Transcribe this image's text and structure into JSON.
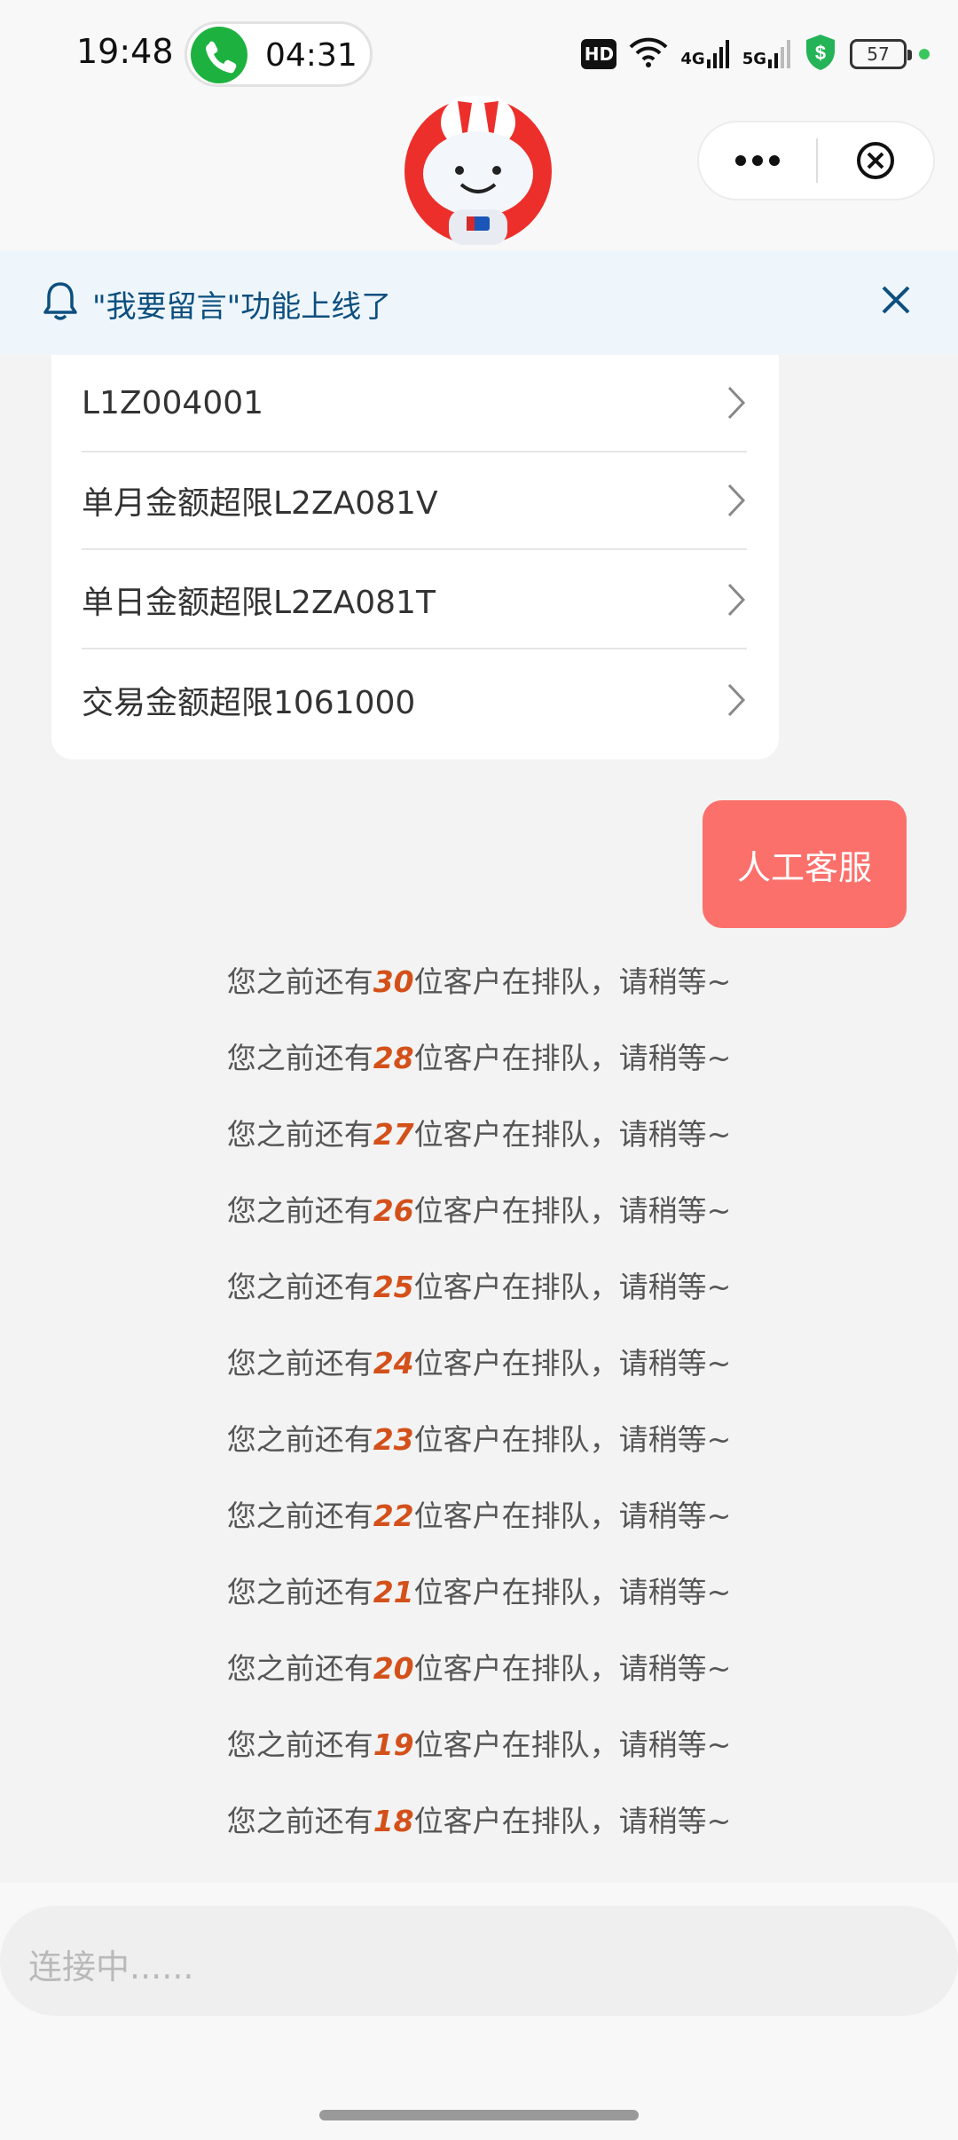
{
  "status_bar": {
    "time": "19:48",
    "call_timer": "04:31",
    "hd_label": "HD",
    "net_4g": "4G",
    "net_5g": "5G",
    "battery": "57"
  },
  "notice": {
    "text": "\"我要留言\"功能上线了"
  },
  "menu": {
    "items": [
      {
        "label": "L1Z004001"
      },
      {
        "label": "单月金额超限L2ZA081V"
      },
      {
        "label": "单日金额超限L2ZA081T"
      },
      {
        "label": "交易金额超限1061000"
      }
    ]
  },
  "chat": {
    "user_bubble": "人工客服"
  },
  "queue": {
    "prefix": "您之前还有",
    "suffix": "位客户在排队，请稍等~",
    "counts": [
      "30",
      "28",
      "27",
      "26",
      "25",
      "24",
      "23",
      "22",
      "21",
      "20",
      "19",
      "18"
    ]
  },
  "input": {
    "placeholder": "连接中......"
  },
  "colors": {
    "bubble": "#fb706b",
    "queue_number": "#d4501a",
    "notice_bg": "#eef6fc",
    "notice_text": "#0d4f7e"
  }
}
